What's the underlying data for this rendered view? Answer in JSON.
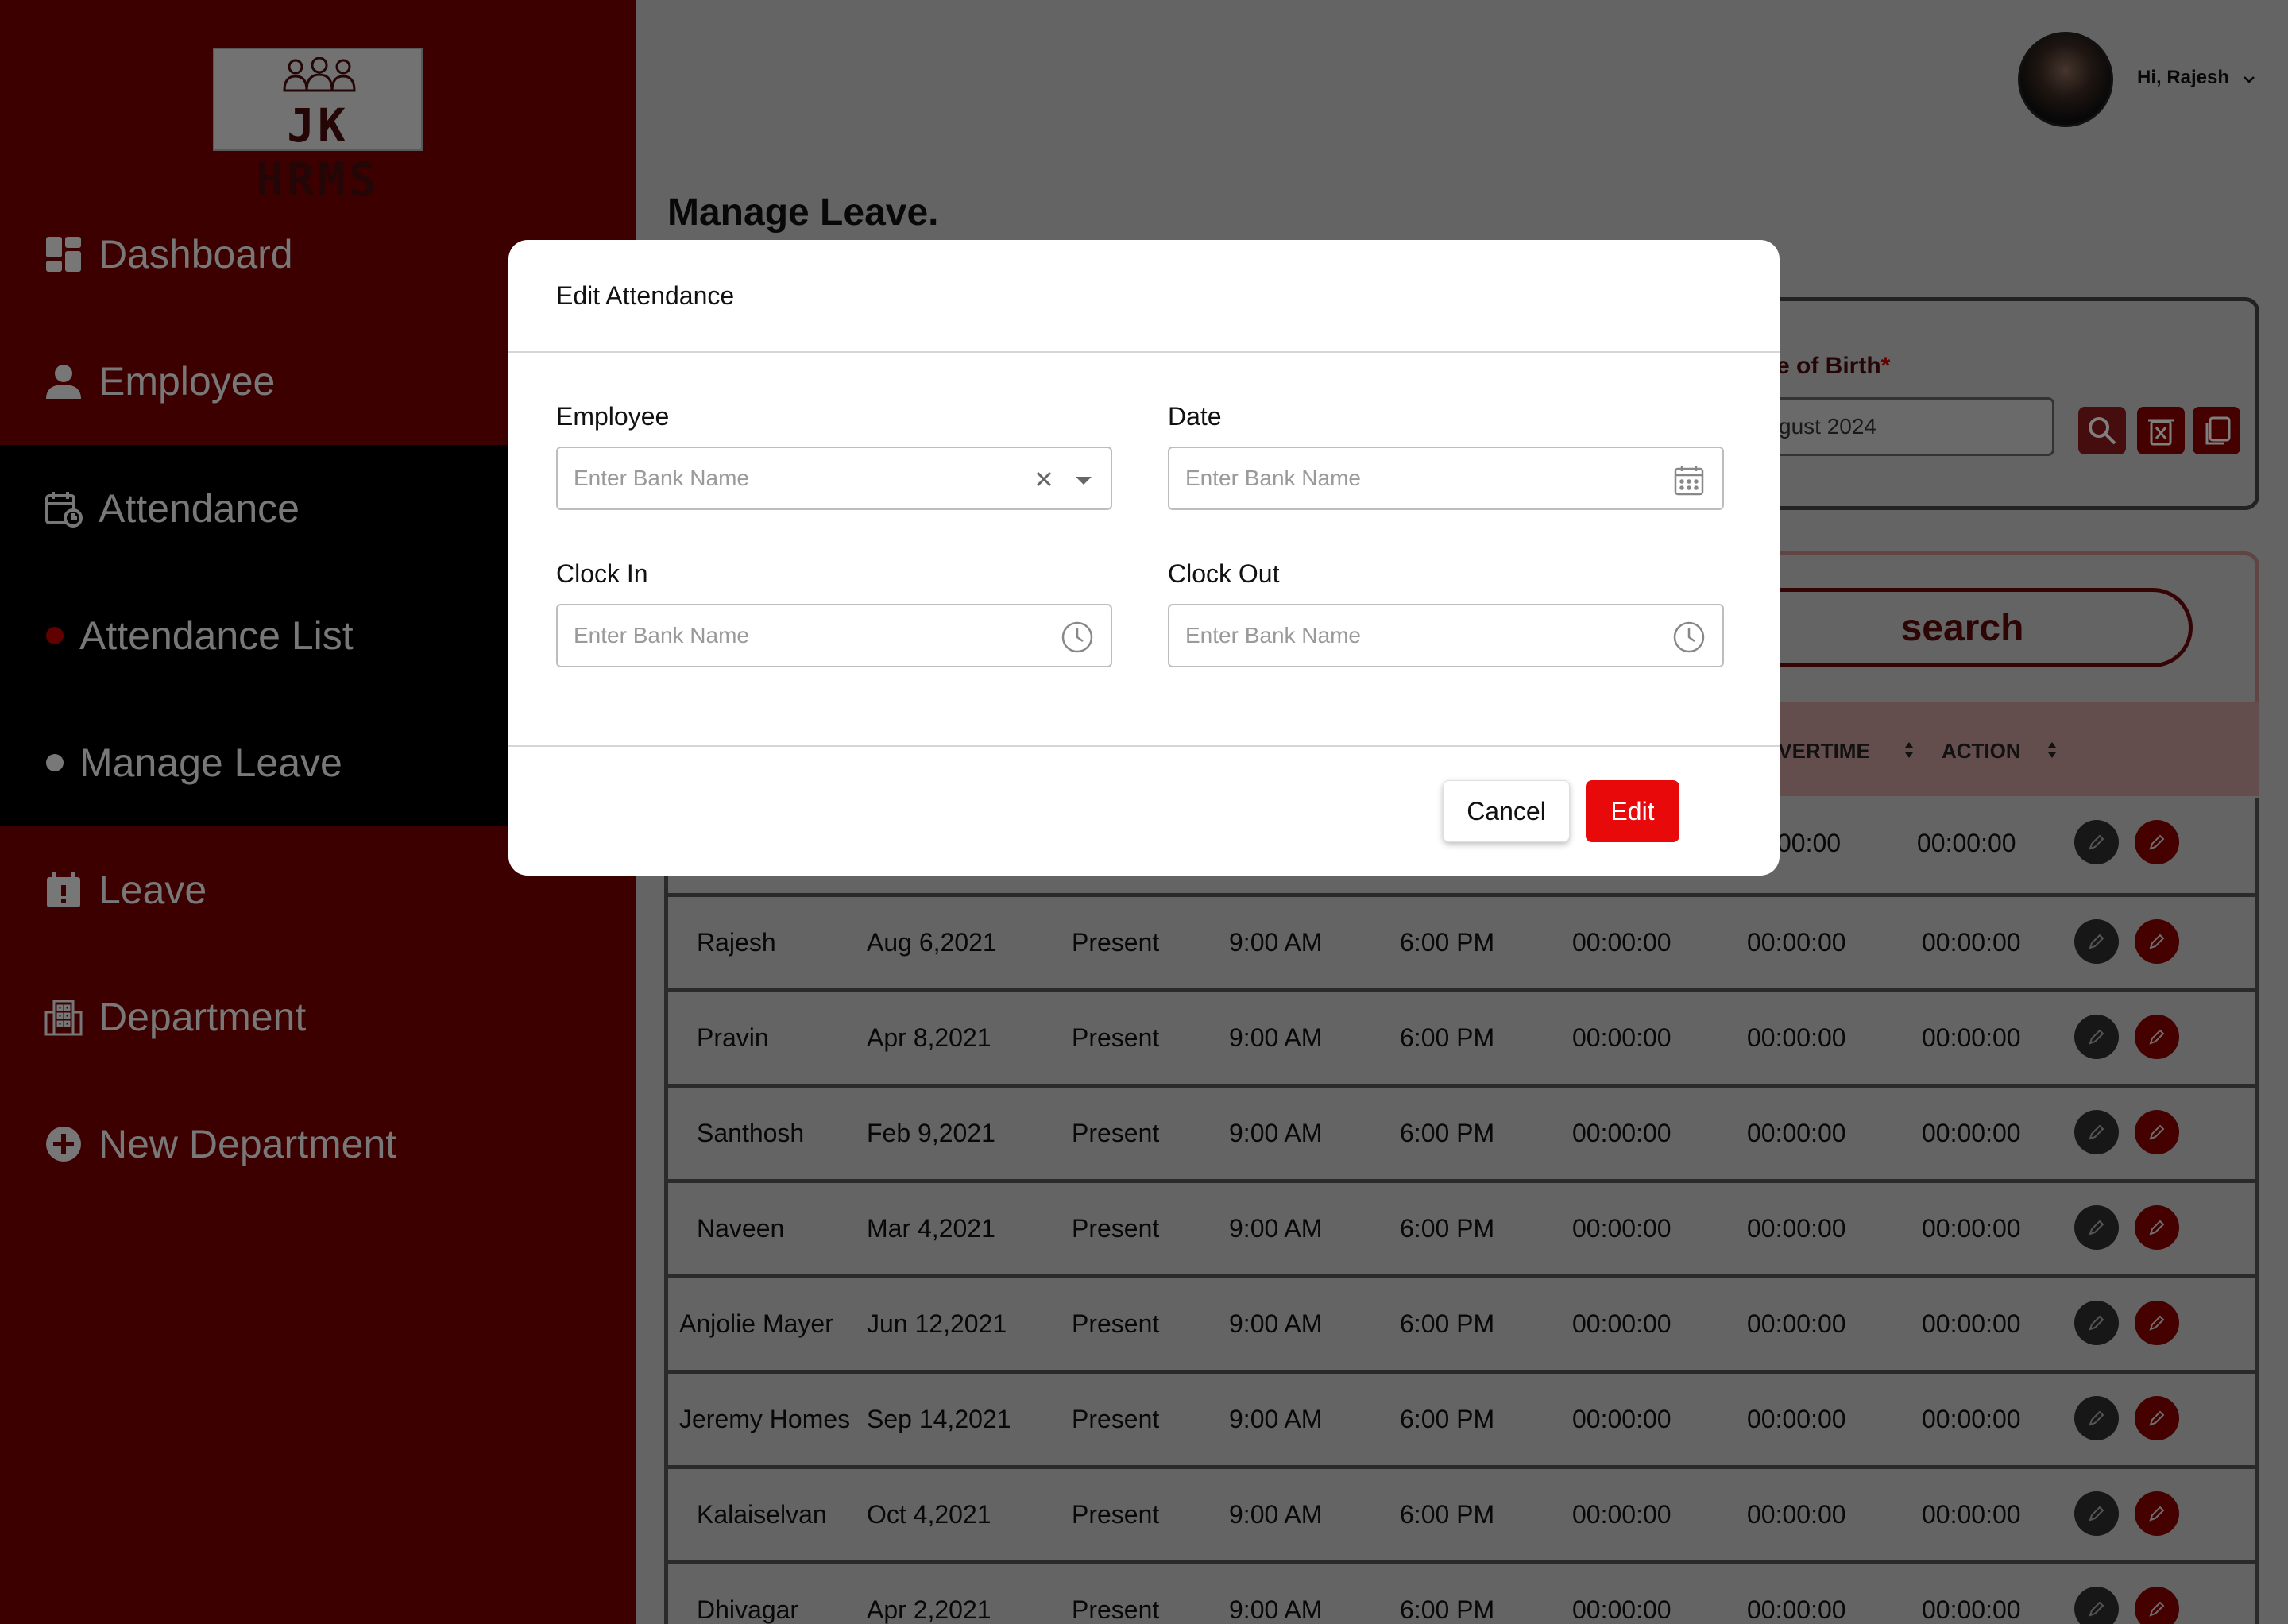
{
  "app": {
    "logo_text": "JK HRMS"
  },
  "sidebar": {
    "items": [
      {
        "label": "Dashboard",
        "icon": "dashboard-icon"
      },
      {
        "label": "Employee",
        "icon": "person-icon"
      },
      {
        "label": "Attendance",
        "icon": "calendar-clock-icon"
      },
      {
        "label": "Attendance List",
        "icon": "bullet-icon"
      },
      {
        "label": "Manage Leave",
        "icon": "bullet-icon"
      },
      {
        "label": "Leave",
        "icon": "calendar-alert-icon"
      },
      {
        "label": "Department",
        "icon": "building-icon"
      },
      {
        "label": "New Department",
        "icon": "plus-circle-icon"
      }
    ]
  },
  "header": {
    "greeting": "Hi, Rajesh"
  },
  "page": {
    "title": "Manage Leave."
  },
  "filter": {
    "dob_label": "e of Birth",
    "dob_required": "*",
    "dob_value": "gust 2024",
    "search_label": "search"
  },
  "table": {
    "headers": {
      "overtime": "OVERTIME",
      "action": "ACTION"
    },
    "first_row_partial": {
      "c6": "00:00",
      "c7": "00:00:00"
    },
    "rows": [
      {
        "name": "Rajesh",
        "date": "Aug 6,2021",
        "status": "Present",
        "in": "9:00 AM",
        "out": "6:00 PM",
        "c5": "00:00:00",
        "c6": "00:00:00",
        "c7": "00:00:00"
      },
      {
        "name": "Pravin",
        "date": "Apr 8,2021",
        "status": "Present",
        "in": "9:00 AM",
        "out": "6:00 PM",
        "c5": "00:00:00",
        "c6": "00:00:00",
        "c7": "00:00:00"
      },
      {
        "name": "Santhosh",
        "date": "Feb 9,2021",
        "status": "Present",
        "in": "9:00 AM",
        "out": "6:00 PM",
        "c5": "00:00:00",
        "c6": "00:00:00",
        "c7": "00:00:00"
      },
      {
        "name": "Naveen",
        "date": "Mar 4,2021",
        "status": "Present",
        "in": "9:00 AM",
        "out": "6:00 PM",
        "c5": "00:00:00",
        "c6": "00:00:00",
        "c7": "00:00:00"
      },
      {
        "name": "Anjolie Mayer",
        "date": "Jun 12,2021",
        "status": "Present",
        "in": "9:00 AM",
        "out": "6:00 PM",
        "c5": "00:00:00",
        "c6": "00:00:00",
        "c7": "00:00:00"
      },
      {
        "name": "Jeremy Homes",
        "date": "Sep 14,2021",
        "status": "Present",
        "in": "9:00 AM",
        "out": "6:00 PM",
        "c5": "00:00:00",
        "c6": "00:00:00",
        "c7": "00:00:00"
      },
      {
        "name": "Kalaiselvan",
        "date": "Oct 4,2021",
        "status": "Present",
        "in": "9:00 AM",
        "out": "6:00 PM",
        "c5": "00:00:00",
        "c6": "00:00:00",
        "c7": "00:00:00"
      },
      {
        "name": "Dhivagar",
        "date": "Apr 2,2021",
        "status": "Present",
        "in": "9:00 AM",
        "out": "6:00 PM",
        "c5": "00:00:00",
        "c6": "00:00:00",
        "c7": "00:00:00"
      }
    ]
  },
  "modal": {
    "title": "Edit Attendance",
    "employee": {
      "label": "Employee",
      "placeholder": "Enter Bank Name"
    },
    "date": {
      "label": "Date",
      "placeholder": "Enter Bank Name"
    },
    "clock_in": {
      "label": "Clock In",
      "placeholder": "Enter Bank Name"
    },
    "clock_out": {
      "label": "Clock Out",
      "placeholder": "Enter Bank Name"
    },
    "cancel_label": "Cancel",
    "edit_label": "Edit"
  },
  "colors": {
    "sidebar_bg": "#7a0000",
    "active_bg": "#000000",
    "edit_button": "#e80a0a",
    "delete_button": "#8a0000"
  }
}
